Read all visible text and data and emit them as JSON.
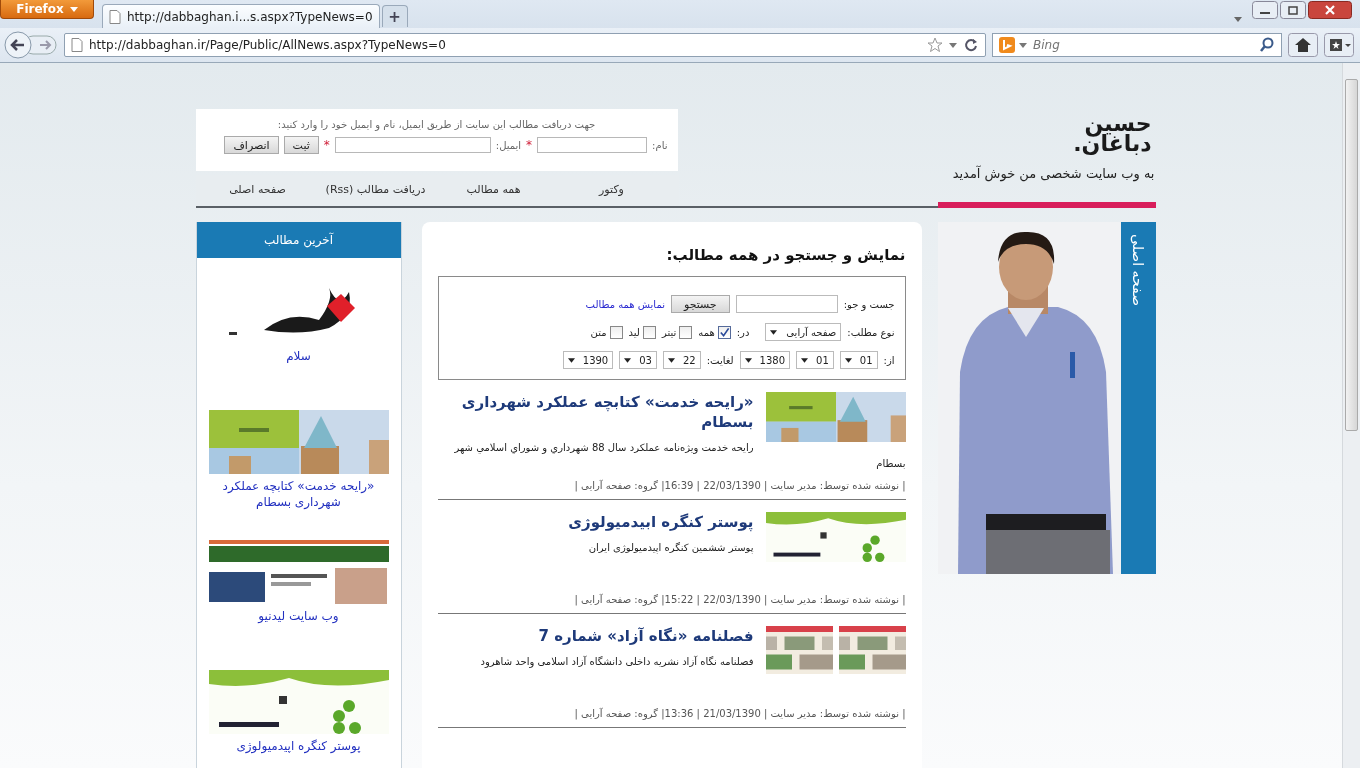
{
  "browser": {
    "app_button": "Firefox",
    "tabs": [
      {
        "title": "http://dabbaghan.i...s.aspx?TypeNews=0",
        "selected": true
      }
    ],
    "new_tab": "+",
    "url": "http://dabbaghan.ir/Page/Public/AllNews.aspx?TypeNews=0",
    "search": {
      "placeholder": "Bing"
    }
  },
  "newsletter": {
    "prompt": "جهت دریافت مطالب این سایت از طریق ایمیل، نام و ایمیل خود را وارد کنید:",
    "fields": [
      {
        "label": "نام:",
        "required_mark": "*"
      },
      {
        "label": "ایمیل:",
        "required_mark": "*"
      }
    ],
    "buttons": [
      "ثبت",
      "انصراف"
    ]
  },
  "nav": [
    "وکتور",
    "همه مطالب",
    "دریافت مطالب (Rss)",
    "صفحه اصلی"
  ],
  "logo": {
    "line1": "حسین",
    "line2": "دباغان."
  },
  "welcome": "به وب سایت شخصی من خوش آمدید",
  "side_tab": "صفحه اصلی",
  "sidebar": {
    "title": "آخرین مطالب",
    "items": [
      {
        "caption": "سلام"
      },
      {
        "caption": "«رایحه خدمت» کتابچه عملکرد شهرداری بسطام"
      },
      {
        "caption": "وب سایت لیدنیو"
      },
      {
        "caption": "پوستر کنگره اپیدمیولوژی"
      }
    ]
  },
  "search": {
    "title": "نمایش و جستجو در همه مطالب:",
    "query_label": "جست و جو:",
    "search_button": "جستجو",
    "show_all_link": "نمایش همه مطالب",
    "type_label": "نوع مطلب:",
    "type_value": "صفحه آرایی",
    "in_label": "در:",
    "scopes": [
      {
        "label": "همه",
        "checked": true
      },
      {
        "label": "تیتر",
        "checked": false
      },
      {
        "label": "لید",
        "checked": false
      },
      {
        "label": "متن",
        "checked": false
      }
    ],
    "from_label": "از:",
    "from": [
      "01",
      "01",
      "1380"
    ],
    "to_label": "لغایت:",
    "to": [
      "22",
      "03",
      "1390"
    ]
  },
  "articles": [
    {
      "title": "«رایحه خدمت» کتابچه عملکرد شهرداری بسطام",
      "summary": "رایحه خدمت ویژه‌نامه عملکرد سال 88 شهرداري و شوراي اسلامي شهر بسطام",
      "meta": "| نوشته شده توسط: مدیر سایت | 22/03/1390 | 16:39| گروه: صفحه آرایی |"
    },
    {
      "title": "پوستر کنگره ابیدمیولوژی",
      "summary": "پوستر ششمین کنگره اپیدمیولوژی ایران",
      "meta": "| نوشته شده توسط: مدیر سایت | 22/03/1390 | 15:22| گروه: صفحه آرایی |"
    },
    {
      "title": "فصلنامه «نگاه آزاد» شماره 7",
      "summary": "فصلنامه نگاه آزاد نشریه داخلی دانشگاه آزاد اسلامی واحد شاهرود",
      "meta": "| نوشته شده توسط: مدیر سایت | 21/03/1390 | 13:36| گروه: صفحه آرایی |"
    }
  ]
}
